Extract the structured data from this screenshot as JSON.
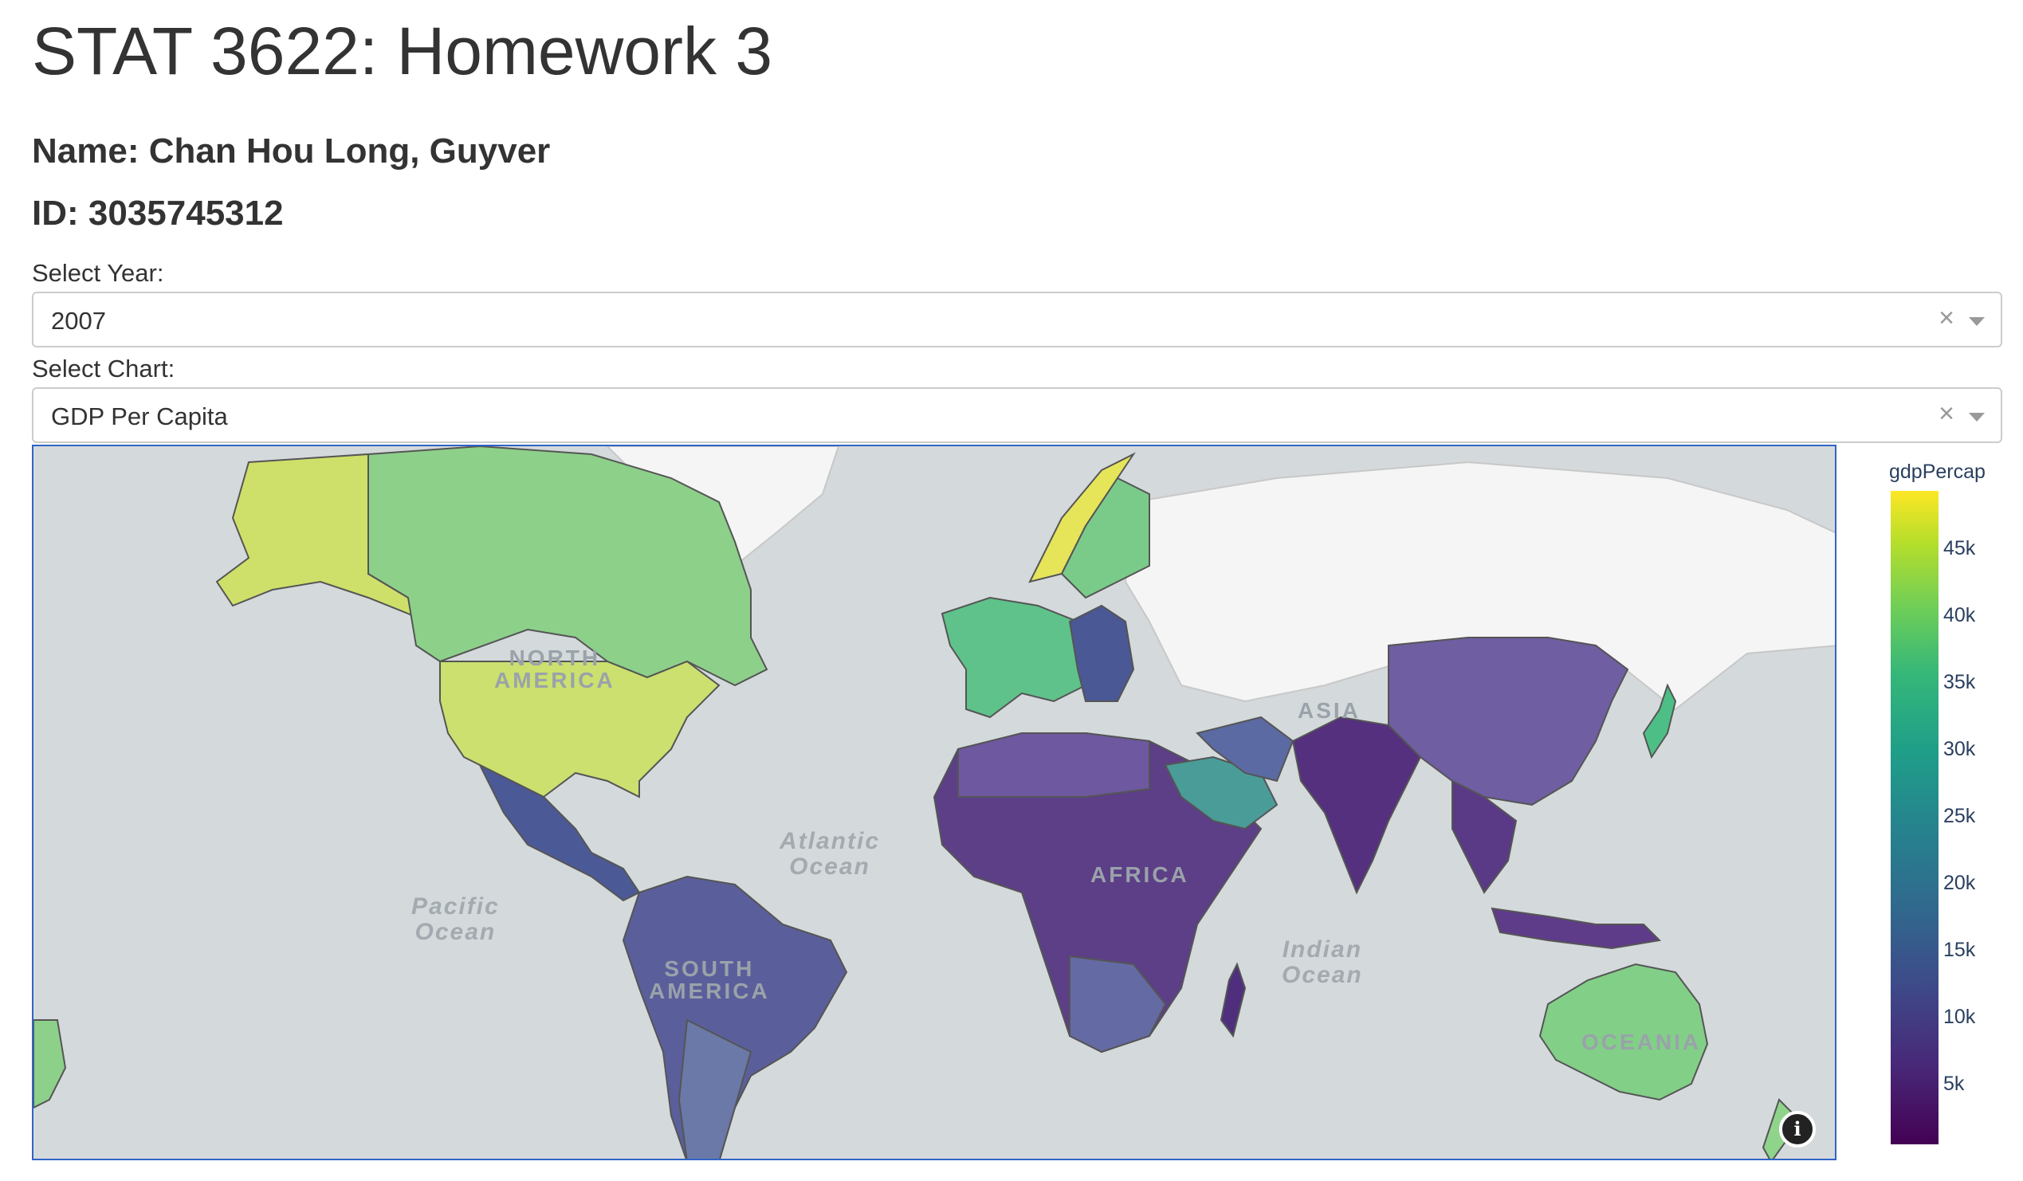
{
  "page": {
    "title": "STAT 3622: Homework 3",
    "name_line": "Name: Chan Hou Long, Guyver",
    "id_line": "ID: 3035745312"
  },
  "controls": {
    "year_label": "Select Year:",
    "year_value": "2007",
    "chart_label": "Select Chart:",
    "chart_value": "GDP Per Capita",
    "clear_glyph": "×"
  },
  "map": {
    "continent_labels": {
      "north_america_1": "NORTH",
      "north_america_2": "AMERICA",
      "south_america_1": "SOUTH",
      "south_america_2": "AMERICA",
      "asia": "ASIA",
      "africa": "AFRICA",
      "oceania": "OCEANIA"
    },
    "ocean_labels": {
      "atlantic_1": "Atlantic",
      "atlantic_2": "Ocean",
      "pacific_1": "Pacific",
      "pacific_2": "Ocean",
      "indian_1": "Indian",
      "indian_2": "Ocean"
    },
    "info_glyph": "i",
    "colors": {
      "ocean": "#d4d9db",
      "land_nodata": "#f5f5f5",
      "usa": "#c8df6e",
      "canada": "#8dd08a",
      "europe_west": "#5fc28a",
      "scandinavia_top": "#e6e55a",
      "russia": "#f5f5f5",
      "latin_america": "#5b5d9a",
      "africa": "#5c3f87",
      "south_asia": "#54307e",
      "china": "#6f5ea2",
      "japan": "#4dbf86",
      "australia": "#82cf87",
      "gulf": "#4a9c99"
    }
  },
  "chart_data": {
    "type": "choropleth",
    "colorbar": {
      "title": "gdpPercap",
      "ticks": [
        "45k",
        "40k",
        "35k",
        "30k",
        "25k",
        "20k",
        "15k",
        "10k",
        "5k"
      ],
      "colorscale": "viridis"
    }
  }
}
